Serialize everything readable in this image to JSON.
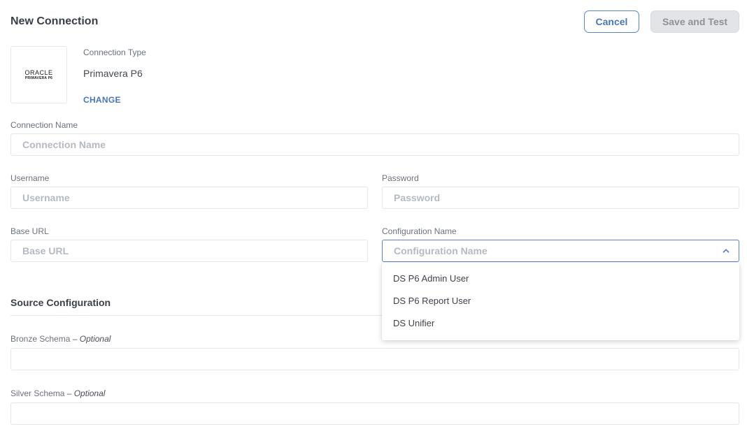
{
  "header": {
    "title": "New Connection",
    "cancel_label": "Cancel",
    "save_label": "Save and Test"
  },
  "connection_type": {
    "label": "Connection Type",
    "value": "Primavera P6",
    "change_label": "CHANGE",
    "logo_brand": "ORACLE",
    "logo_product": "PRIMAVERA P6"
  },
  "fields": {
    "connection_name": {
      "label": "Connection Name",
      "placeholder": "Connection Name"
    },
    "username": {
      "label": "Username",
      "placeholder": "Username"
    },
    "password": {
      "label": "Password",
      "placeholder": "Password"
    },
    "base_url": {
      "label": "Base URL",
      "placeholder": "Base URL"
    },
    "configuration_name": {
      "label": "Configuration Name",
      "placeholder": "Configuration Name",
      "options": [
        "DS P6 Admin User",
        "DS P6 Report User",
        "DS Unifier"
      ]
    }
  },
  "source_configuration": {
    "title": "Source Configuration",
    "bronze_schema": {
      "label": "Bronze Schema",
      "optional": "– Optional"
    },
    "silver_schema": {
      "label": "Silver Schema",
      "optional": "– Optional"
    }
  },
  "colors": {
    "accent": "#4a74bf",
    "disabled_bg": "#e3e4e7",
    "border": "#e4e6e9"
  }
}
